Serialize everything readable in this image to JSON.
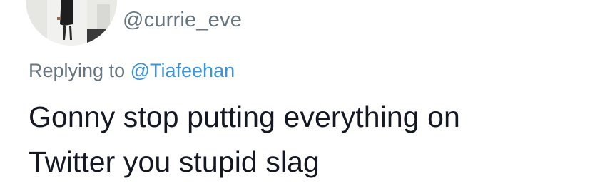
{
  "author": {
    "handle": "@currie_eve",
    "avatar_icon": "profile-photo"
  },
  "reply": {
    "prefix": "Replying to",
    "mention": "@Tiafeehan"
  },
  "tweet": {
    "lines": [
      "Gonny stop putting everything on",
      "Twitter you stupid slag"
    ]
  },
  "colors": {
    "secondary_text": "#66757f",
    "link": "#3b94d9",
    "primary_text": "#141823"
  }
}
